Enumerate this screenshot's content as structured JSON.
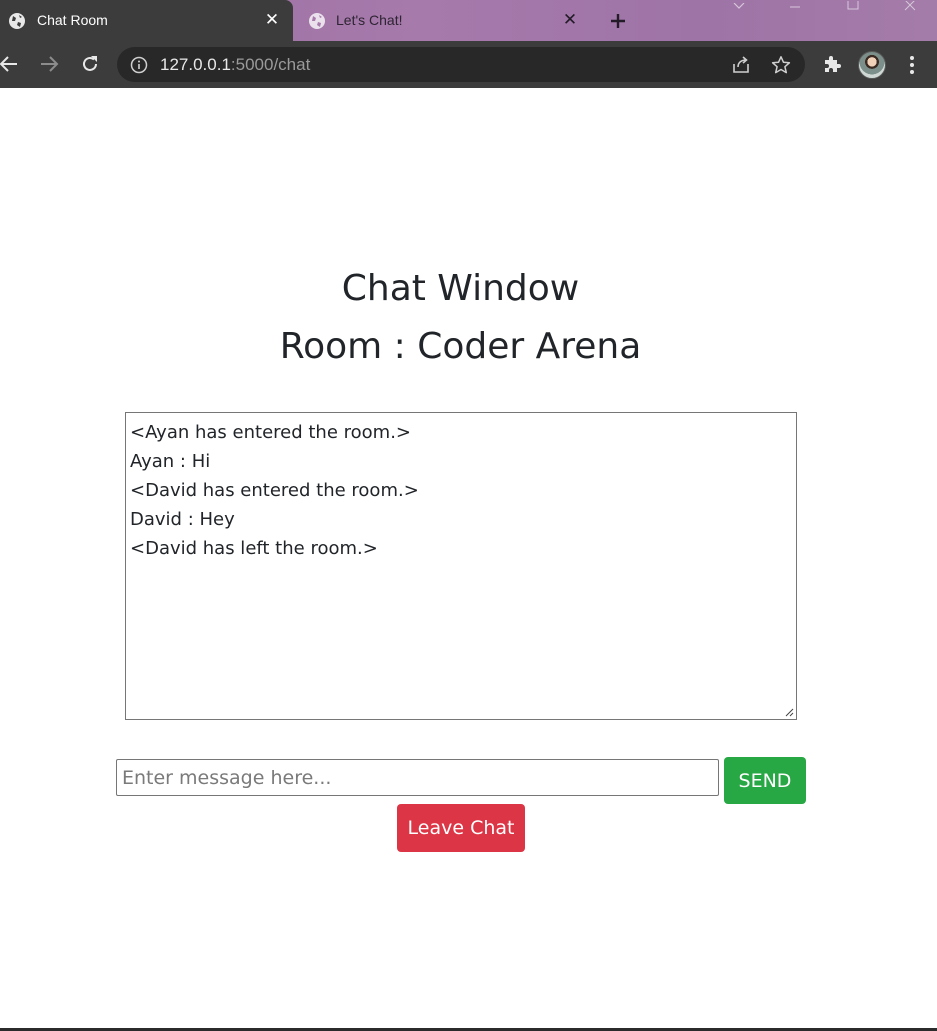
{
  "browser": {
    "tabs": [
      {
        "title": "Chat Room",
        "active": true
      },
      {
        "title": "Let's Chat!",
        "active": false
      }
    ],
    "address": {
      "host": "127.0.0.1",
      "path": ":5000/chat"
    },
    "icons": [
      "globe-icon",
      "close-icon",
      "plus-icon",
      "back-icon",
      "forward-icon",
      "reload-icon",
      "info-icon",
      "share-icon",
      "star-icon",
      "puzzle-icon",
      "menu-icon"
    ],
    "colors": {
      "chrome_dark": "#3c3c3c",
      "omnibox": "#282828",
      "tabstrip": "#a67aab"
    }
  },
  "page": {
    "title": "Chat Window",
    "room": "Room : Coder Arena",
    "chat_lines": [
      "<Ayan has entered the room.>",
      "Ayan : Hi",
      "<David has entered the room.>",
      "David : Hey",
      "<David has left the room.>"
    ],
    "input": {
      "placeholder": "Enter message here...",
      "value": ""
    },
    "send_label": "SEND",
    "leave_label": "Leave Chat",
    "colors": {
      "send": "#28a745",
      "leave": "#dc3545",
      "text": "#212529"
    }
  }
}
